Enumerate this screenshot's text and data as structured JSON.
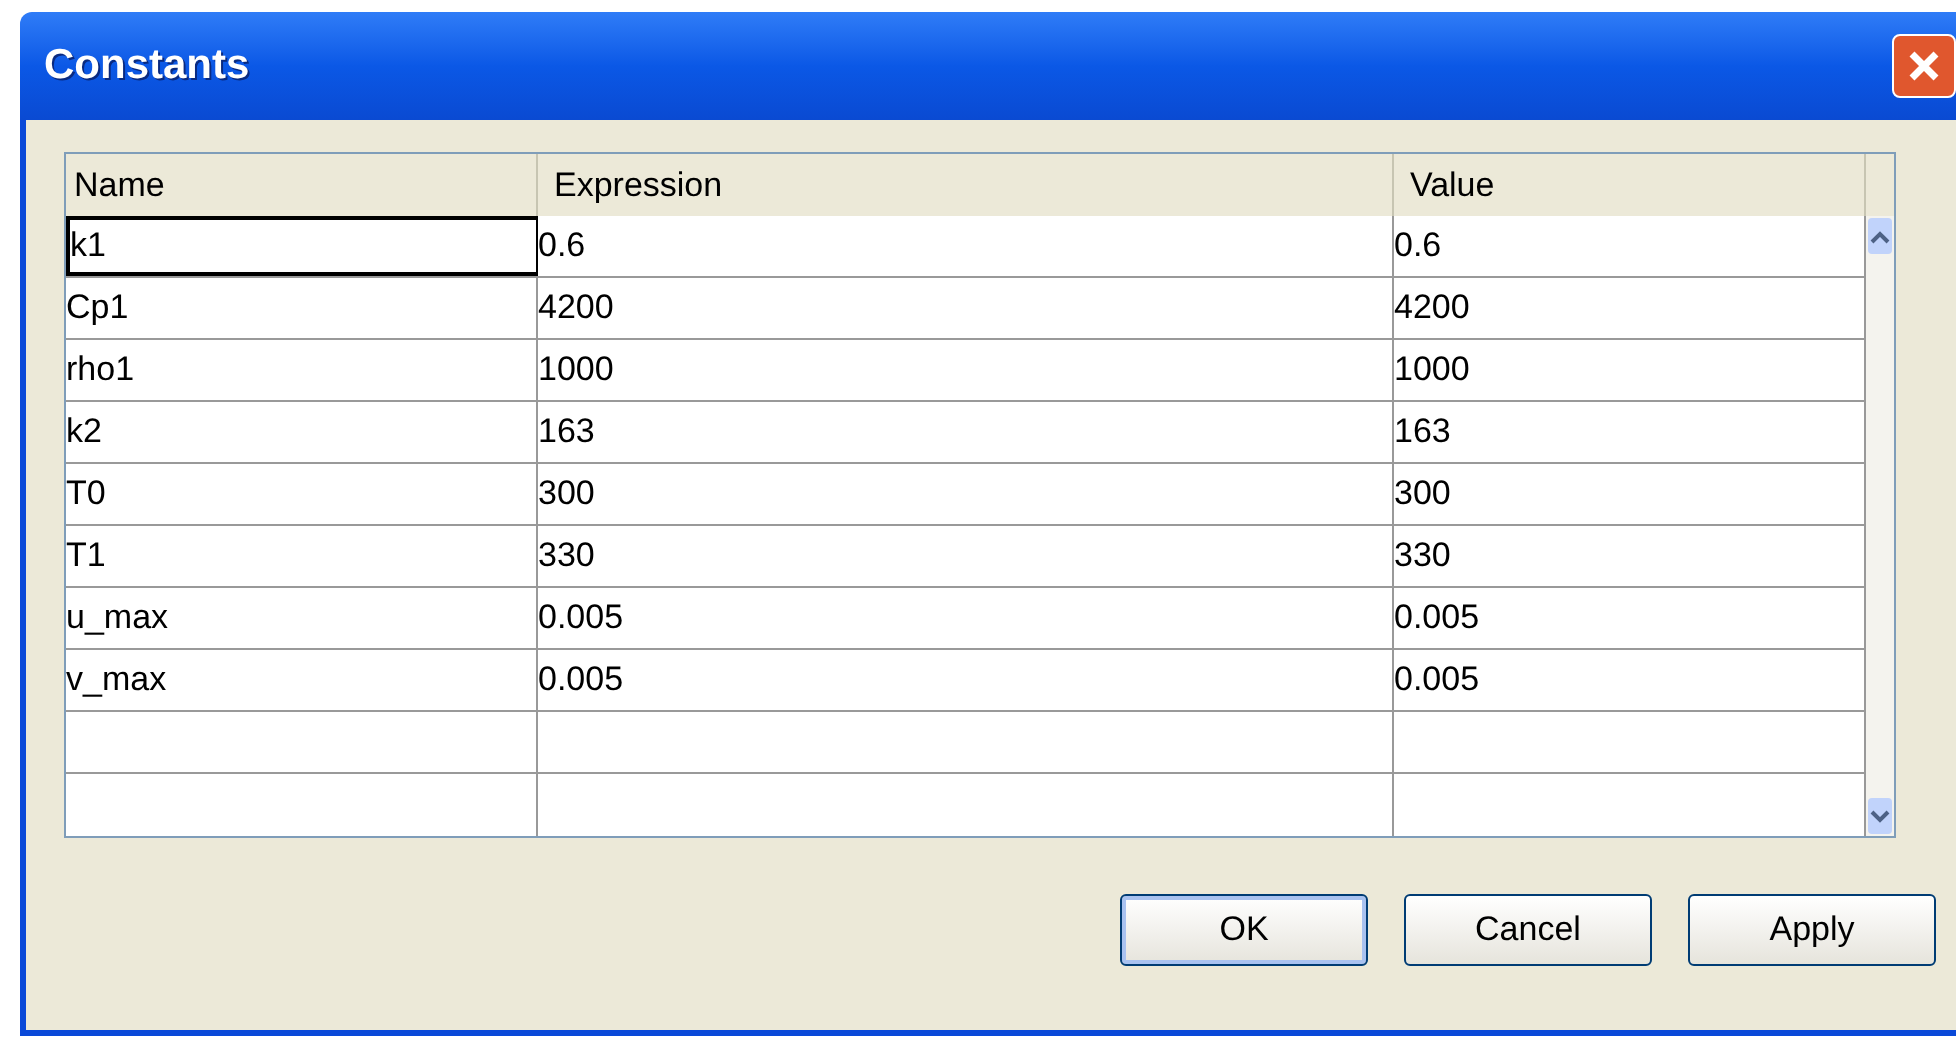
{
  "window": {
    "title": "Constants"
  },
  "table": {
    "columns": [
      "Name",
      "Expression",
      "Value"
    ],
    "rows": [
      {
        "cells": [
          "k1",
          "0.6",
          "0.6"
        ],
        "selected": true
      },
      {
        "cells": [
          "Cp1",
          "4200",
          "4200"
        ],
        "selected": false
      },
      {
        "cells": [
          "rho1",
          "1000",
          "1000"
        ],
        "selected": false
      },
      {
        "cells": [
          "k2",
          "163",
          "163"
        ],
        "selected": false
      },
      {
        "cells": [
          "T0",
          "300",
          "300"
        ],
        "selected": false
      },
      {
        "cells": [
          "T1",
          "330",
          "330"
        ],
        "selected": false
      },
      {
        "cells": [
          "u_max",
          "0.005",
          "0.005"
        ],
        "selected": false
      },
      {
        "cells": [
          "v_max",
          "0.005",
          "0.005"
        ],
        "selected": false
      },
      {
        "cells": [],
        "selected": false
      },
      {
        "cells": [],
        "selected": false
      }
    ]
  },
  "buttons": [
    {
      "label": "OK",
      "default": true
    },
    {
      "label": "Cancel",
      "default": false
    },
    {
      "label": "Apply",
      "default": false
    }
  ]
}
